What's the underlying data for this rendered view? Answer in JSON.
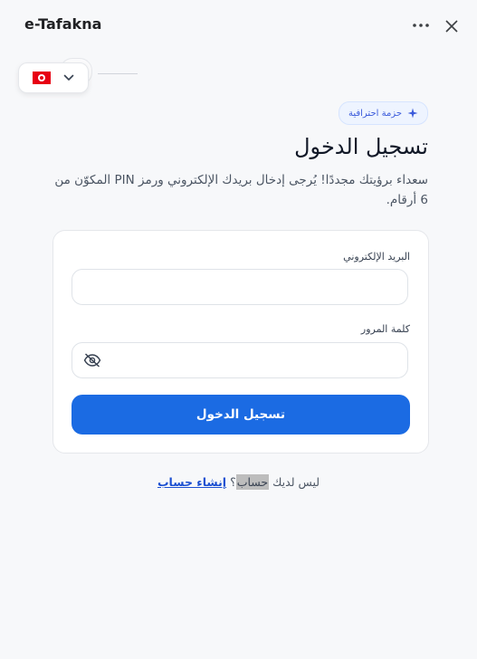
{
  "window": {
    "title": "e-Tafakna",
    "more_icon": "more-dots-icon",
    "close_icon": "close-icon"
  },
  "language_selector": {
    "flag": "tunisia-flag-icon",
    "chevron_icon": "chevron-down-icon"
  },
  "badge": {
    "label": "حزمة احترافية",
    "icon": "sparkle-icon"
  },
  "login": {
    "title": "تسجيل الدخول",
    "subtitle": "سعداء برؤيتك مجددًا! يُرجى إدخال بريدك الإلكتروني ورمز PIN المكوّن من 6 أرقام.",
    "email_label": "البريد الإلكتروني",
    "email_value": "",
    "password_label": "كلمة المرور",
    "password_value": "",
    "password_toggle_icon": "eye-off-icon",
    "submit_label": "تسجيل الدخول"
  },
  "footer": {
    "prefix": "ليس لديك ",
    "highlighted": "حساب",
    "suffix": "؟ ",
    "link_label": "إنشاء حساب"
  },
  "colors": {
    "primary": "#1b6be3",
    "badge_bg": "#eef4ff",
    "link": "#1b4fd1"
  }
}
